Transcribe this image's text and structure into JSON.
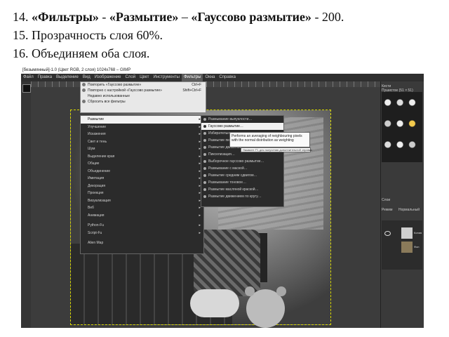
{
  "instructions": {
    "line1_num": "14.",
    "line1_filters": "«Фильтры»",
    "line1_dash1": " - ",
    "line1_blur": "«Размытие»",
    "line1_dash2": " – ",
    "line1_gauss": "«Гауссово размытие»",
    "line1_tail": " - 200.",
    "line2": "15. Прозрачность слоя  60%.",
    "line3": "16. Объединяем оба слоя."
  },
  "window": {
    "title": "[безымянный]-1.0 (Цвет RGB, 2 слоя) 1024x768 – GIMP"
  },
  "menubar": [
    "Файл",
    "Правка",
    "Выделение",
    "Вид",
    "Изображение",
    "Слой",
    "Цвет",
    "Инструменты",
    "Фильтры",
    "Окна",
    "Справка"
  ],
  "filters_top_menu": [
    {
      "label": "Повторить «Гауссово размытие»",
      "key": "Ctrl+F"
    },
    {
      "label": "Повторно с настройкой «Гауссово размытие»",
      "key": "Shift+Ctrl+F"
    },
    {
      "label": "Недавно использованные",
      "key": ""
    },
    {
      "label": "Сбросить все фильтры",
      "key": ""
    }
  ],
  "filters_submenu": [
    {
      "label": "Размытие",
      "arrow": "▸"
    },
    {
      "label": "Улучшение",
      "arrow": "▸"
    },
    {
      "label": "Искажения",
      "arrow": "▸"
    },
    {
      "label": "Свет и тень",
      "arrow": "▸"
    },
    {
      "label": "Шум",
      "arrow": "▸"
    },
    {
      "label": "Выделение края",
      "arrow": "▸"
    },
    {
      "label": "Общие",
      "arrow": "▸"
    },
    {
      "label": "Объединение",
      "arrow": "▸"
    },
    {
      "label": "Имитация",
      "arrow": "▸"
    },
    {
      "label": "Декорация",
      "arrow": "▸"
    },
    {
      "label": "Проекция",
      "arrow": "▸"
    },
    {
      "label": "Визуализация",
      "arrow": "▸"
    },
    {
      "label": "Веб",
      "arrow": "▸"
    },
    {
      "label": "Анимация",
      "arrow": "▸"
    },
    {
      "label": "Python-Fu",
      "arrow": "▸"
    },
    {
      "label": "Script-Fu",
      "arrow": "▸"
    },
    {
      "label": "Alien Map",
      "arrow": ""
    }
  ],
  "blur_submenu": [
    "Размывание выпуклости…",
    "Гауссово размытие…",
    "Избирательное размытие…",
    "Размытие пикселизацией…",
    "Размытие движением…",
    "Пикселизация…",
    "Выборочное гауссово размытие…",
    "Размывание с маской…",
    "Размытие средним сдвигом…",
    "Размывание тоновое…",
    "Размытие масляной краской…",
    "Размытие движением по кругу…"
  ],
  "tooltip": {
    "text": "Performs an averaging of neighbouring pixels with the normal distribution as weighting",
    "hint": "Нажмите F1 для получения дополнительной справки"
  },
  "right_panel": {
    "brushes_title": "Кисти",
    "brush_name": "Пушистое (51 × 51)",
    "layers_title": "Слои",
    "mode_label": "Режим",
    "mode_value": "Нормальный",
    "layers": [
      {
        "name": "Копия"
      },
      {
        "name": "Фон"
      }
    ]
  }
}
